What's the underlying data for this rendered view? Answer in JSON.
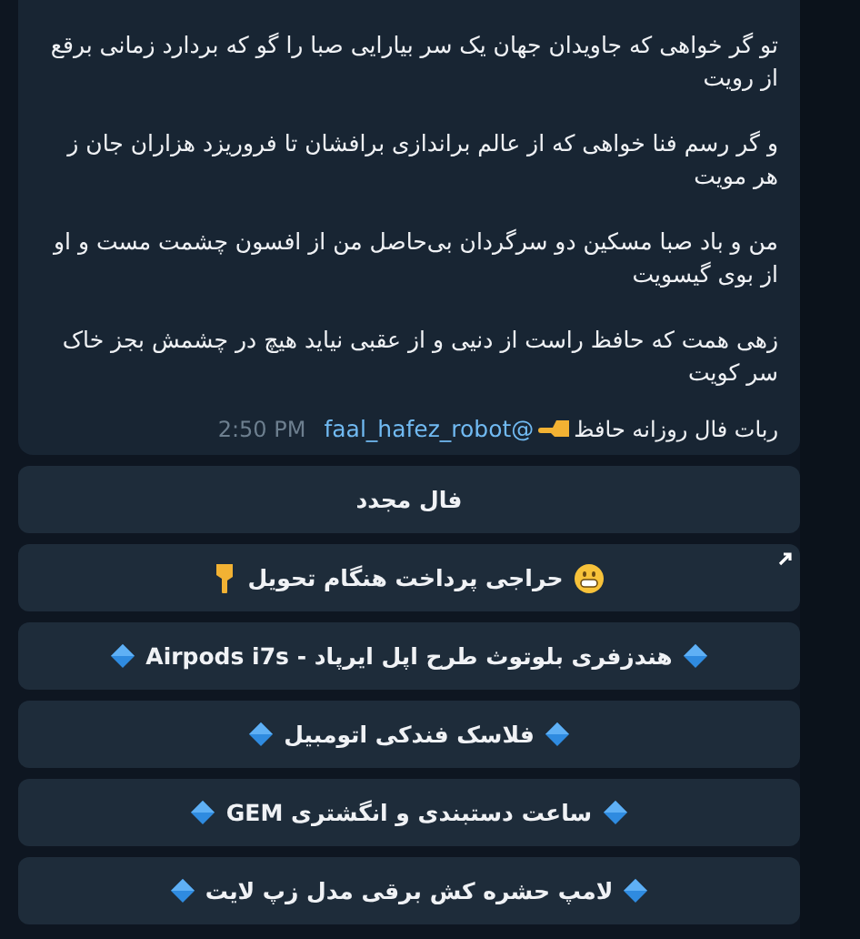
{
  "message": {
    "verses": [
      "تو گر خواهی که جاویدان جهان یک سر بیارایی   صبا را گو که بردارد زمانی برقع از رویت",
      "و گر رسم فنا خواهی که از عالم براندازی   برافشان تا فروریزد هزاران جان ز هر مویت",
      "من و باد صبا مسکین دو سرگردان بی‌حاصل   من از افسون چشمت مست و او از بوی گیسویت",
      "زهی همت که حافظ راست از دنیی و از عقبی   نیاید هیچ در چشمش بجز خاک سر کویت"
    ],
    "signature": "ربات فال روزانه حافظ",
    "mention": "@faal_hafez_robot",
    "time": "2:50 PM"
  },
  "buttons": [
    {
      "kind": "plain",
      "label": "فال مجدد"
    },
    {
      "kind": "promo",
      "label": "حراجی پرداخت هنگام تحویل"
    },
    {
      "kind": "diamond",
      "label": "هندزفری بلوتوث طرح اپل ایرپاد - Airpods i7s"
    },
    {
      "kind": "diamond",
      "label": "فلاسک فندکی اتومبیل"
    },
    {
      "kind": "diamond",
      "label": "ساعت دستبندی و انگشتری GEM"
    },
    {
      "kind": "diamond",
      "label": "لامپ حشره کش برقی مدل زپ لایت"
    }
  ]
}
